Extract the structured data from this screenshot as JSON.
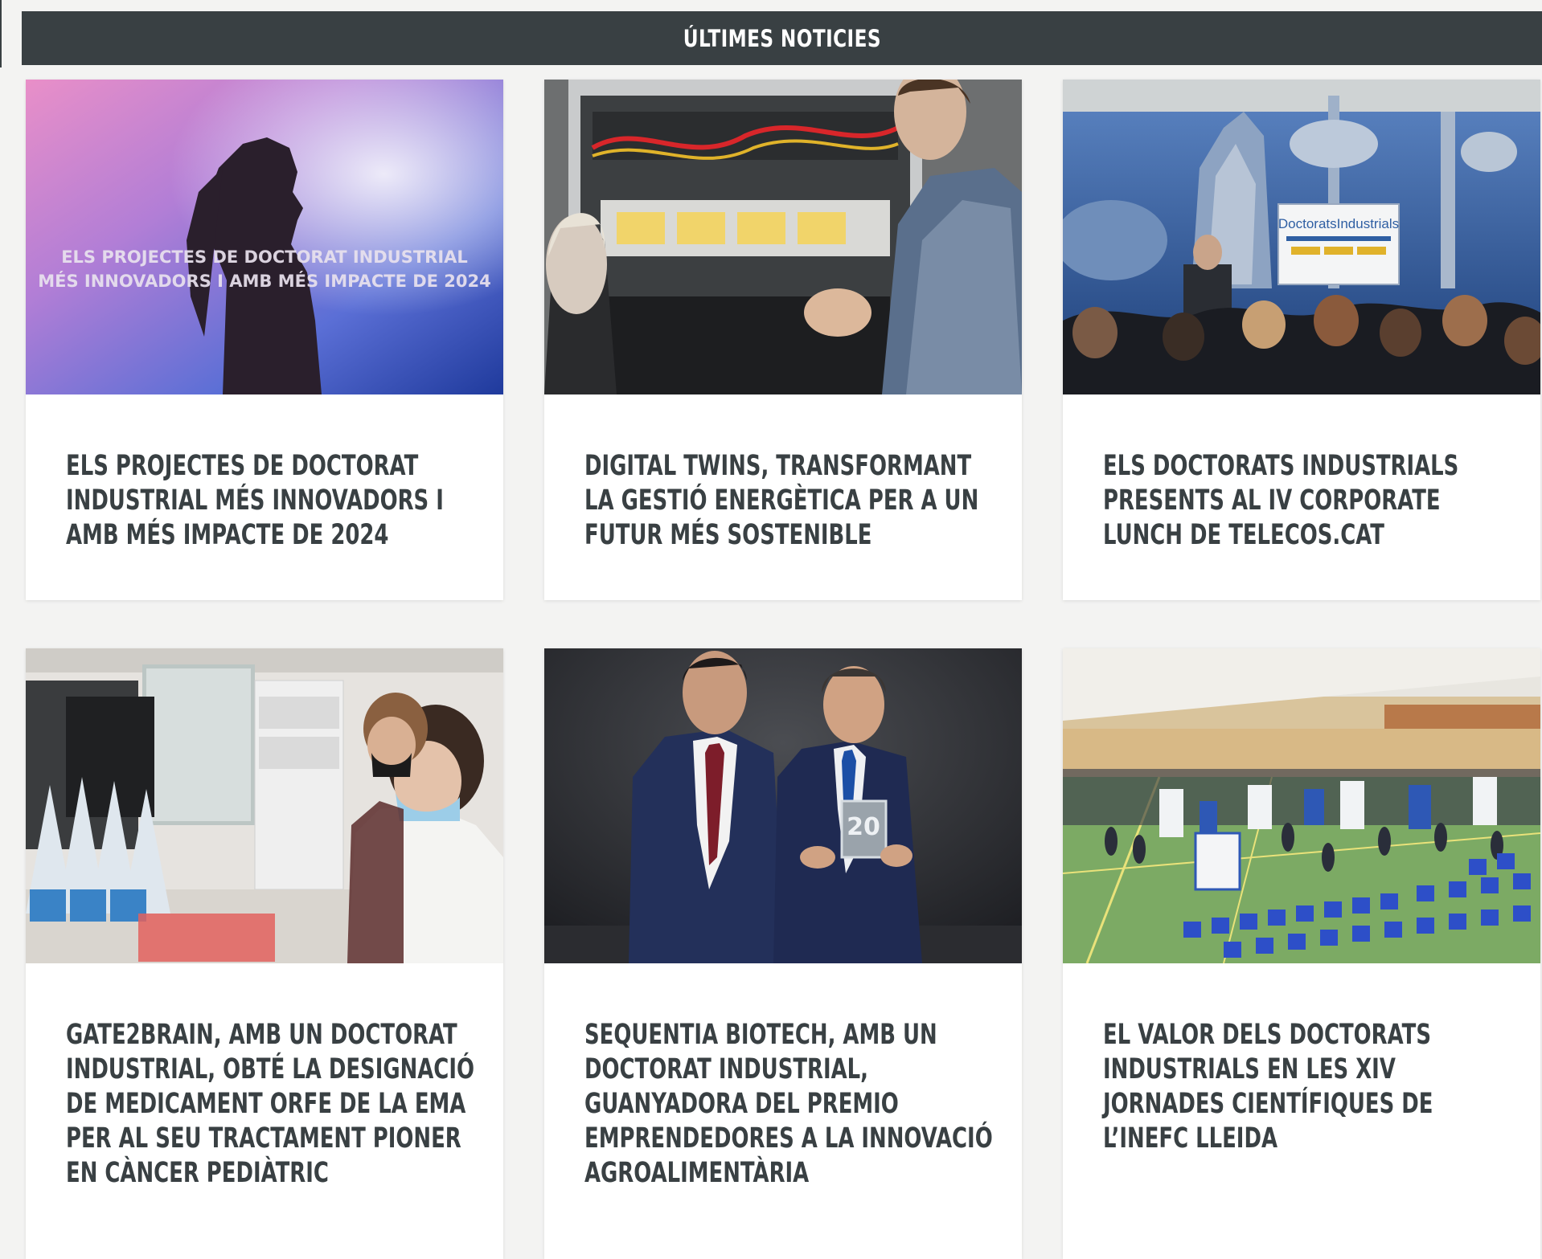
{
  "section": {
    "title": "ÚLTIMES NOTICIES"
  },
  "news": [
    {
      "title": "ELS PROJECTES DE DOCTORAT INDUSTRIAL MÉS INNOVADORS I AMB MÉS IMPACTE DE 2024",
      "image_caption_line1": "ELS PROJECTES DE DOCTORAT INDUSTRIAL",
      "image_caption_line2": "MÉS INNOVADORS I AMB MÉS IMPACTE DE 2024"
    },
    {
      "title": "DIGITAL TWINS, TRANSFORMANT LA GESTIÓ ENERGÈTICA PER A UN FUTUR MÉS SOSTENIBLE"
    },
    {
      "title": "ELS DOCTORATS INDUSTRIALS PRESENTS AL IV CORPORATE LUNCH DE TELECOS.CAT",
      "image_sign": "DoctoratsIndustrials"
    },
    {
      "title": "GATE2BRAIN, AMB UN DOCTORAT INDUSTRIAL, OBTÉ LA DESIGNACIÓ DE MEDICAMENT ORFE DE LA EMA PER AL SEU TRACTAMENT PIONER EN CÀNCER PEDIÀTRIC"
    },
    {
      "title": "SEQUENTIA BIOTECH, AMB UN DOCTORAT INDUSTRIAL, GUANYADORA DEL PREMIO EMPRENDEDORES A LA INNOVACIÓ AGROALIMENTÀRIA",
      "image_award": "20"
    },
    {
      "title": "EL VALOR DELS DOCTORATS INDUSTRIALS EN LES XIV JORNADES CIENTÍFIQUES DE L’INEFC LLEIDA"
    }
  ],
  "colors": {
    "header_bg": "#394043",
    "title_text": "#394043",
    "page_bg": "#f3f3f2",
    "card_bg": "#ffffff"
  }
}
